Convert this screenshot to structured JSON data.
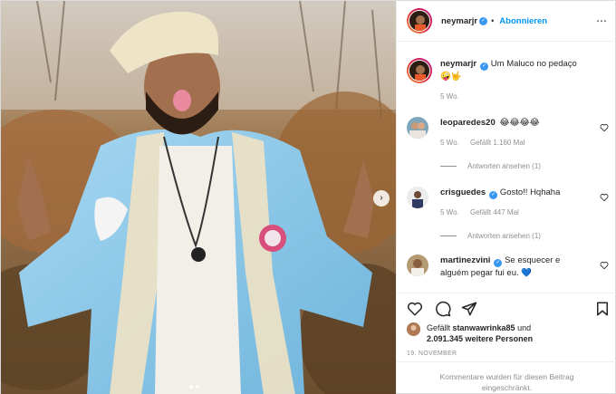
{
  "post": {
    "author": "neymarjr",
    "follow_label": "Abonnieren",
    "more_icon": "⋯",
    "carousel": {
      "total_slides": 2,
      "active_index": 0
    }
  },
  "caption": {
    "username": "neymarjr",
    "text": "Um Maluco no pedaço 🤪🤟",
    "time": "5 Wo."
  },
  "comments": [
    {
      "username": "leoparedes20",
      "text": "😂😂😂😂",
      "time": "5 Wo.",
      "likes": "Gefällt 1.160 Mal",
      "replies": "Antworten ansehen (1)",
      "verified": false
    },
    {
      "username": "crisguedes",
      "text": "Gosto!! Hqhaha",
      "time": "5 Wo.",
      "likes": "Gefällt 447 Mal",
      "replies": "Antworten ansehen (1)",
      "verified": true
    },
    {
      "username": "martinezvini",
      "text": "Se esquecer e alguém pegar fui eu. 💙",
      "verified": true
    }
  ],
  "likes_info": {
    "prefix": "Gefällt",
    "user": "stanwawrinka85",
    "conjunction": "und",
    "count": "2.091.345 weitere Personen"
  },
  "date": "19. NOVEMBER",
  "comments_closed": "Kommentare wurden für diesen Beitrag eingeschränkt.",
  "colors": {
    "accent": "#0095f6",
    "verified": "#3897f0",
    "muted": "#8e8e8e",
    "jacket": "#8ecbea",
    "border": "#efefef"
  }
}
